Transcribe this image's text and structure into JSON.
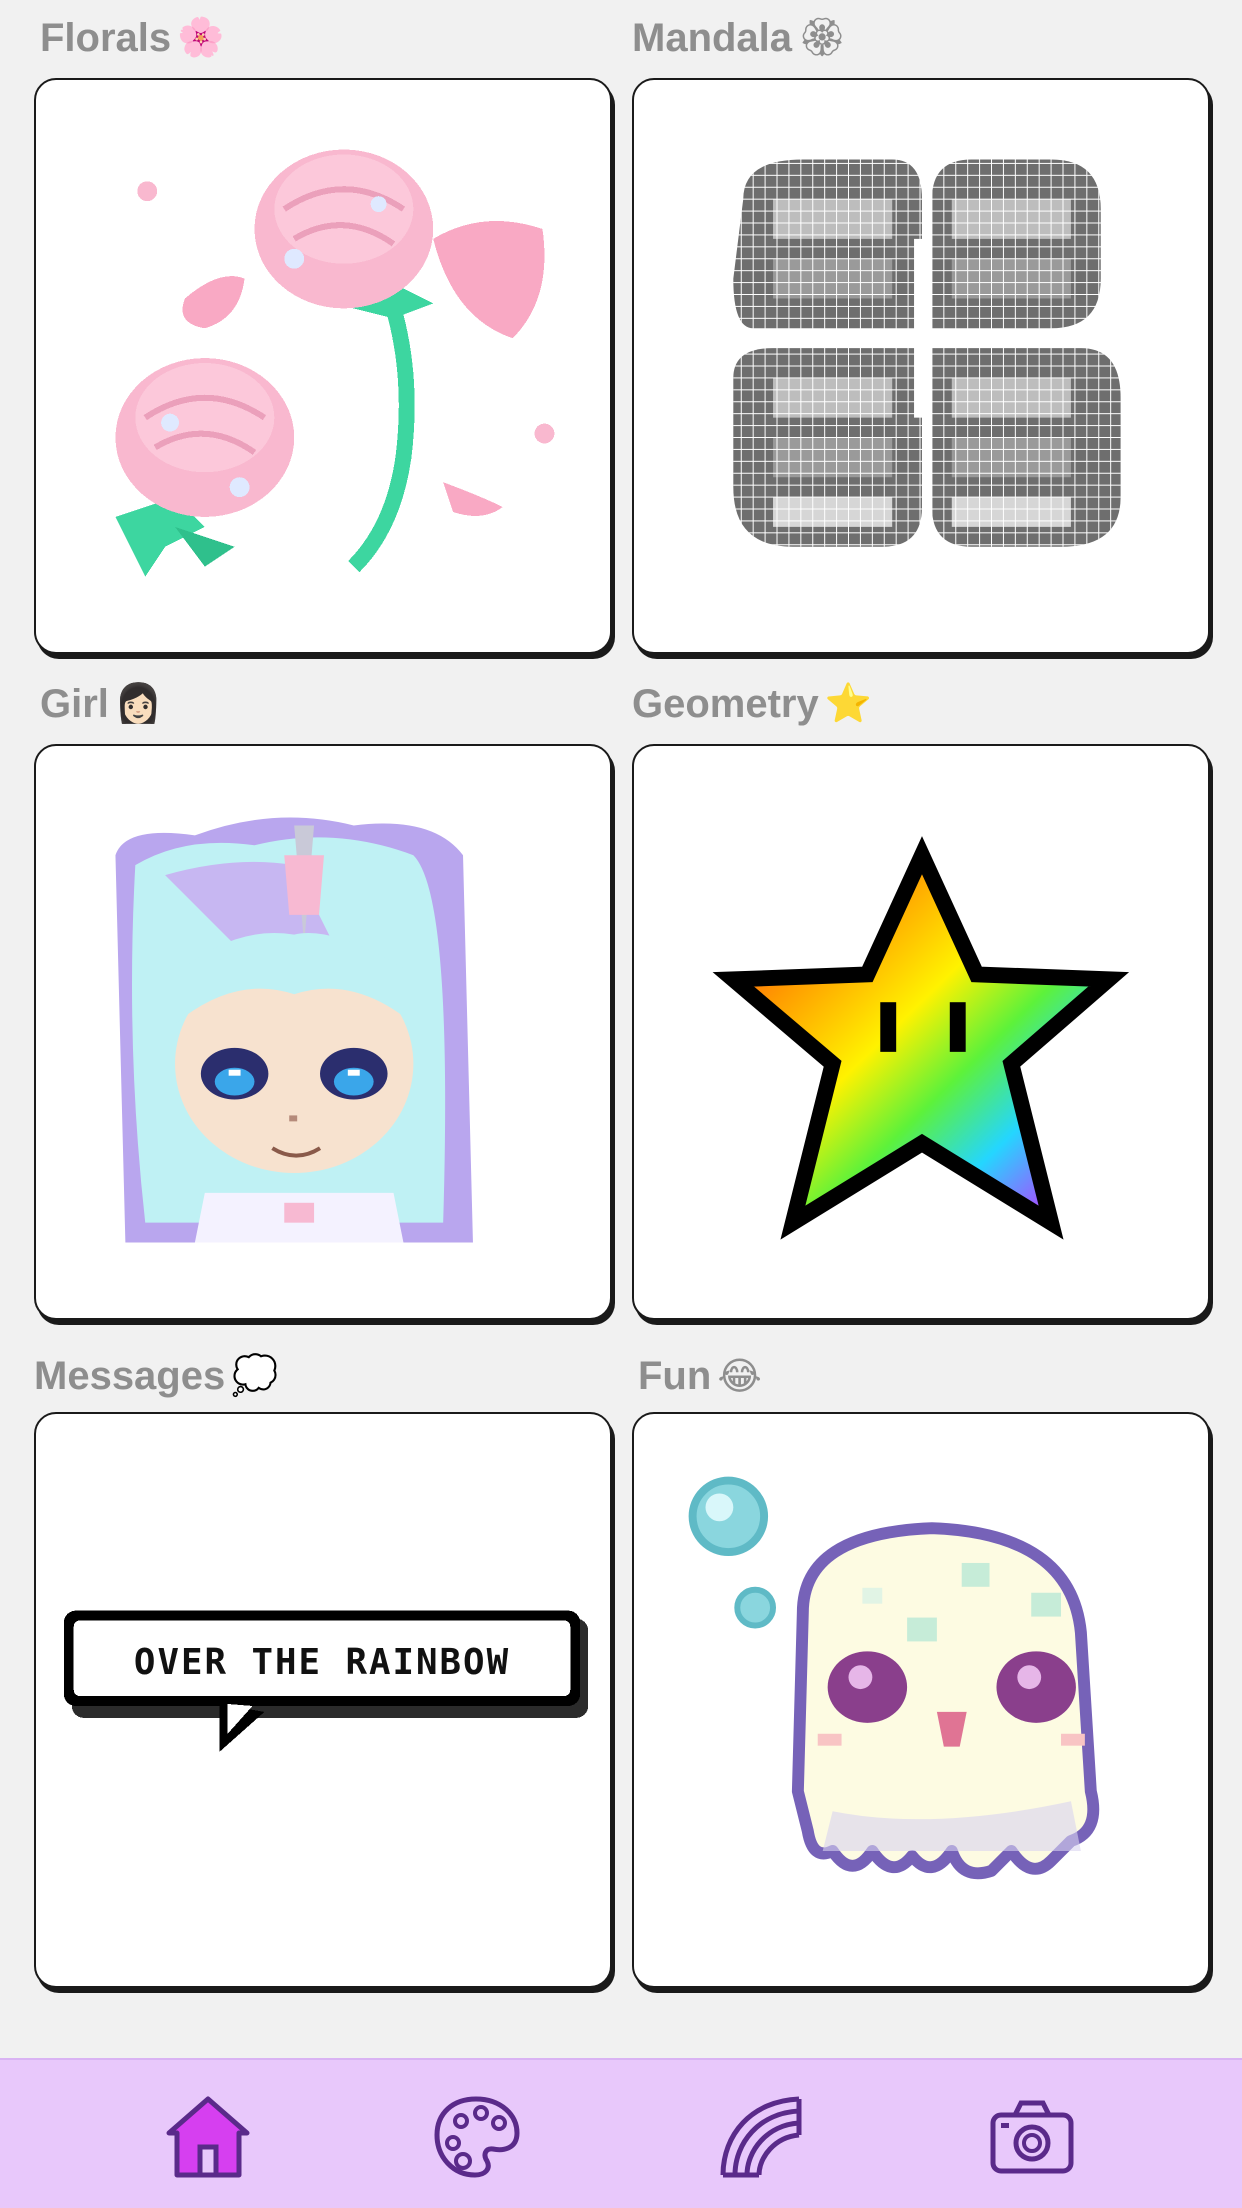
{
  "categories": [
    {
      "label": "Florals",
      "emoji": "🌸"
    },
    {
      "label": "Mandala",
      "emoji": "🏵"
    },
    {
      "label": "Girl",
      "emoji": "👩🏻"
    },
    {
      "label": "Geometry",
      "emoji": "⭐"
    },
    {
      "label": "Messages",
      "emoji": "💭"
    },
    {
      "label": "Fun",
      "emoji": "😂"
    }
  ],
  "cards": {
    "messages_bubble_text": "OVER THE RAINBOW"
  },
  "bottom_nav": {
    "items": [
      "home-icon",
      "palette-icon",
      "rainbow-icon",
      "camera-icon"
    ],
    "active": "home-icon",
    "active_color": "#d63ff0",
    "icon_color": "#5a2a8a",
    "bar_color": "#e8c8fb"
  }
}
